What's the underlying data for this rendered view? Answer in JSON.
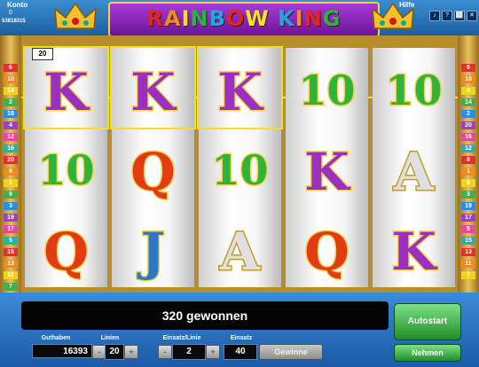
{
  "header": {
    "konto_label": "Konto",
    "konto_value": "0",
    "session_id": "53818315",
    "hilfe_label": "Hilfe",
    "logo_text": "RAINBOW KING",
    "icons": [
      "sound-icon",
      "help-icon",
      "fullscreen-icon",
      "close-icon"
    ]
  },
  "paylines_left": [
    "6",
    "10",
    "14",
    "2",
    "18",
    "4",
    "12",
    "16",
    "20",
    "8",
    "1",
    "9",
    "3",
    "19",
    "17",
    "5",
    "15",
    "13",
    "11",
    "7"
  ],
  "paylines_right": [
    "6",
    "10",
    "4",
    "14",
    "2",
    "20",
    "16",
    "12",
    "8",
    "1",
    "9",
    "3",
    "19",
    "17",
    "5",
    "15",
    "13",
    "11",
    "7"
  ],
  "winning_line_badge": "20",
  "reels": [
    [
      "K",
      "10",
      "Q"
    ],
    [
      "K",
      "Q",
      "J"
    ],
    [
      "K",
      "10",
      "A"
    ],
    [
      "10",
      "K",
      "Q"
    ],
    [
      "10",
      "A",
      "K"
    ]
  ],
  "symbol_colors": {
    "K": "#9b2fc0",
    "Q": "#e23a15",
    "J": "#2a78c8",
    "A": "#e0e0e0",
    "10": "#2cb53c"
  },
  "message": "320 gewonnen",
  "controls": {
    "guthaben_label": "Guthaben",
    "guthaben_value": "16393",
    "linien_label": "Linien",
    "linien_value": "20",
    "einsatz_linie_label": "Einsatz/Linie",
    "einsatz_linie_value": "2",
    "einsatz_label": "Einsatz",
    "einsatz_value": "40",
    "gewinne_label": "Gewinne",
    "autostart_label": "Autostart",
    "nehmen_label": "Nehmen",
    "minus": "-",
    "plus": "+"
  }
}
